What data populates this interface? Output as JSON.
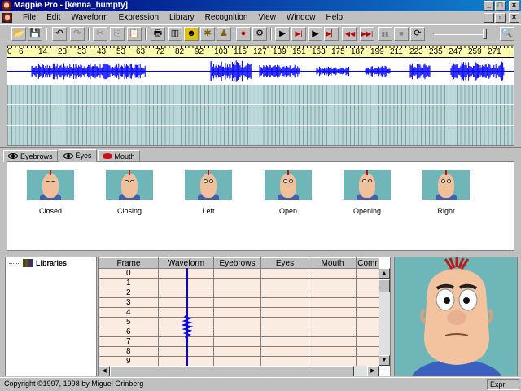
{
  "window": {
    "title": "Magpie Pro - [kenna_humpty]",
    "buttons": [
      "_",
      "□",
      "×"
    ]
  },
  "menubar": {
    "items": [
      "File",
      "Edit",
      "Waveform",
      "Expression",
      "Library",
      "Recognition",
      "View",
      "Window",
      "Help"
    ],
    "doc_buttons": [
      "_",
      "▫",
      "×"
    ]
  },
  "toolbar": {
    "icons": [
      "open-icon",
      "save-icon",
      "undo-icon",
      "redo-icon",
      "cut-icon",
      "copy-icon",
      "paste-icon",
      "print-icon",
      "frames-icon",
      "expression-icon",
      "library-icon",
      "person-icon",
      "record-icon",
      "recognize-icon",
      "play-icon",
      "play-selection-icon",
      "play-to-icon",
      "play-from-icon",
      "rewind-icon",
      "fast-forward-icon",
      "pause-icon",
      "stop-icon",
      "loop-icon",
      "zoom-icon"
    ],
    "glyphs": {
      "open": "📂",
      "save": "💾",
      "undo": "↶",
      "redo": "↷",
      "cut": "✂",
      "copy": "⎘",
      "paste": "📋",
      "print": "🖶",
      "frames": "▥",
      "expression": "☻",
      "library": "✱",
      "person": "♟",
      "record": "●",
      "recognize": "⚙",
      "play": "▶",
      "play_sel": "▶|",
      "play_to": "|▶",
      "play_from": "▶▏",
      "rewind": "|◀◀",
      "ffwd": "▶▶|",
      "pause": "▮▮",
      "stop": "■",
      "loop": "⟳",
      "zoom": "🔍"
    },
    "volume_level": 0.92
  },
  "timeline": {
    "ruler_labels": [
      "6",
      "14",
      "23",
      "33",
      "43",
      "53",
      "63",
      "72",
      "82",
      "92",
      "103",
      "115",
      "127",
      "139",
      "151",
      "163",
      "175",
      "187",
      "199",
      "211",
      "223",
      "235",
      "247",
      "259",
      "271"
    ],
    "ruler_prefix": "0",
    "wave_color": "#0000ff",
    "track_color": "#7aa6a8"
  },
  "tabs": [
    {
      "label": "Eyebrows",
      "icon": "eye-icon"
    },
    {
      "label": "Eyes",
      "icon": "eye-icon",
      "active": true
    },
    {
      "label": "Mouth",
      "icon": "lips-icon"
    }
  ],
  "expressions": [
    "Closed",
    "Closing",
    "Left",
    "Open",
    "Opening",
    "Right"
  ],
  "libraries": {
    "label": "Libraries"
  },
  "sheet": {
    "columns": [
      "Frame",
      "Waveform",
      "Eyebrows",
      "Eyes",
      "Mouth",
      "Comr"
    ],
    "frames": [
      "0",
      "1",
      "2",
      "3",
      "4",
      "5",
      "6",
      "7",
      "8",
      "9"
    ],
    "row_color": "#fcebe0"
  },
  "status": {
    "text": "Copyright ©1997, 1998 by Miguel Grinberg",
    "right": "Expr"
  }
}
